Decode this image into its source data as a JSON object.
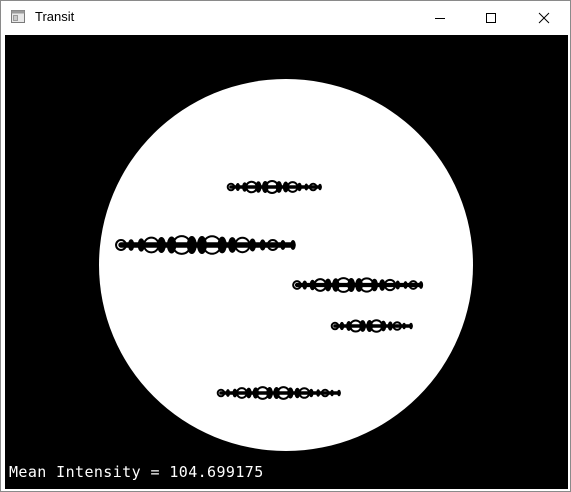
{
  "window": {
    "title": "Transit",
    "icons": {
      "app": "app-window-icon",
      "minimize": "minimize-icon",
      "maximize": "maximize-icon",
      "close": "close-icon"
    }
  },
  "canvas": {
    "background_color": "#000000",
    "disk_color": "#ffffff",
    "mark_color": "#000000",
    "status": {
      "label": "Mean Intensity = ",
      "value": "104.699175"
    }
  }
}
